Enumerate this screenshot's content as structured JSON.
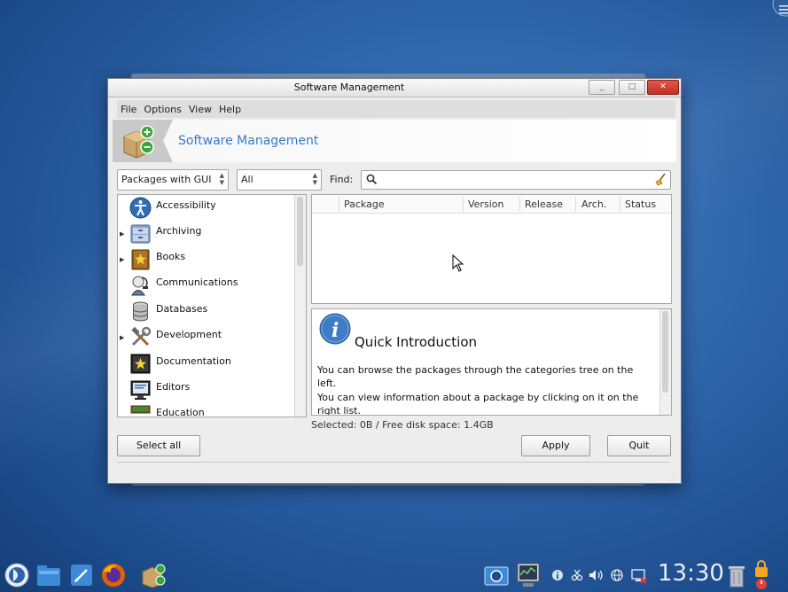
{
  "window": {
    "title": "Software Management",
    "controls": {
      "minimize": "_",
      "maximize": "□",
      "close": "✕"
    }
  },
  "menu": [
    "File",
    "Options",
    "View",
    "Help"
  ],
  "header": {
    "title": "Software Management",
    "icon": "package-add-remove-icon"
  },
  "filters": {
    "type_combo": "Packages with GUI",
    "status_combo": "All",
    "find_label": "Find:",
    "search_value": "",
    "search_icon": "search-icon",
    "clear_icon": "broom-icon"
  },
  "categories": [
    {
      "label": "Accessibility",
      "expandable": false,
      "icon": "accessibility-icon"
    },
    {
      "label": "Archiving",
      "expandable": true,
      "icon": "archive-icon"
    },
    {
      "label": "Books",
      "expandable": true,
      "icon": "book-icon"
    },
    {
      "label": "Communications",
      "expandable": false,
      "icon": "communications-icon"
    },
    {
      "label": "Databases",
      "expandable": false,
      "icon": "database-icon"
    },
    {
      "label": "Development",
      "expandable": true,
      "icon": "development-tools-icon"
    },
    {
      "label": "Documentation",
      "expandable": false,
      "icon": "documentation-icon"
    },
    {
      "label": "Editors",
      "expandable": false,
      "icon": "editor-icon"
    },
    {
      "label": "Education",
      "expandable": false,
      "icon": "education-icon"
    }
  ],
  "table": {
    "columns": [
      "",
      "Package",
      "Version",
      "Release",
      "Arch.",
      "Status"
    ],
    "rows": []
  },
  "info": {
    "icon": "info-icon",
    "heading": "Quick Introduction",
    "para1": "You can browse the packages through the categories tree on the left.",
    "para2": "You can view information about a package by clicking on it on the right list."
  },
  "status": "Selected: 0B / Free disk space: 1.4GB",
  "buttons": {
    "select_all": "Select all",
    "apply": "Apply",
    "quit": "Quit"
  },
  "taskbar": {
    "clock": "13:30",
    "launchers": [
      "app-menu-icon",
      "file-manager-icon",
      "text-editor-icon",
      "firefox-icon",
      "software-manager-icon"
    ],
    "tray": [
      "screenshot-icon",
      "system-monitor-icon",
      "info-icon",
      "clipboard-icon",
      "volume-icon",
      "network-icon",
      "display-icon",
      "trash-icon",
      "power-icon"
    ]
  },
  "colors": {
    "accent": "#3a78c4",
    "close": "#d0433a",
    "desktop": "#2d63a8"
  }
}
